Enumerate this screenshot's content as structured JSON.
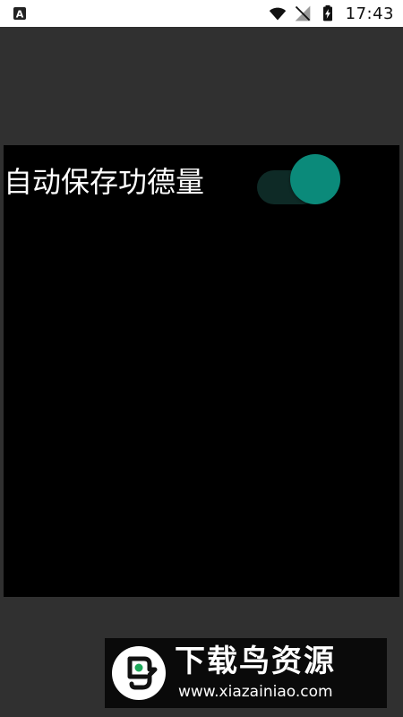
{
  "status_bar": {
    "time": "17:43",
    "icons": [
      "app-notification-icon",
      "wifi-icon",
      "no-signal-icon",
      "battery-charging-icon"
    ]
  },
  "setting": {
    "label": "自动保存功德量",
    "toggle_on": true,
    "accent_color": "#0b8a7a"
  },
  "watermark": {
    "title": "下载鸟资源",
    "url": "www.xiazainiao.com"
  }
}
